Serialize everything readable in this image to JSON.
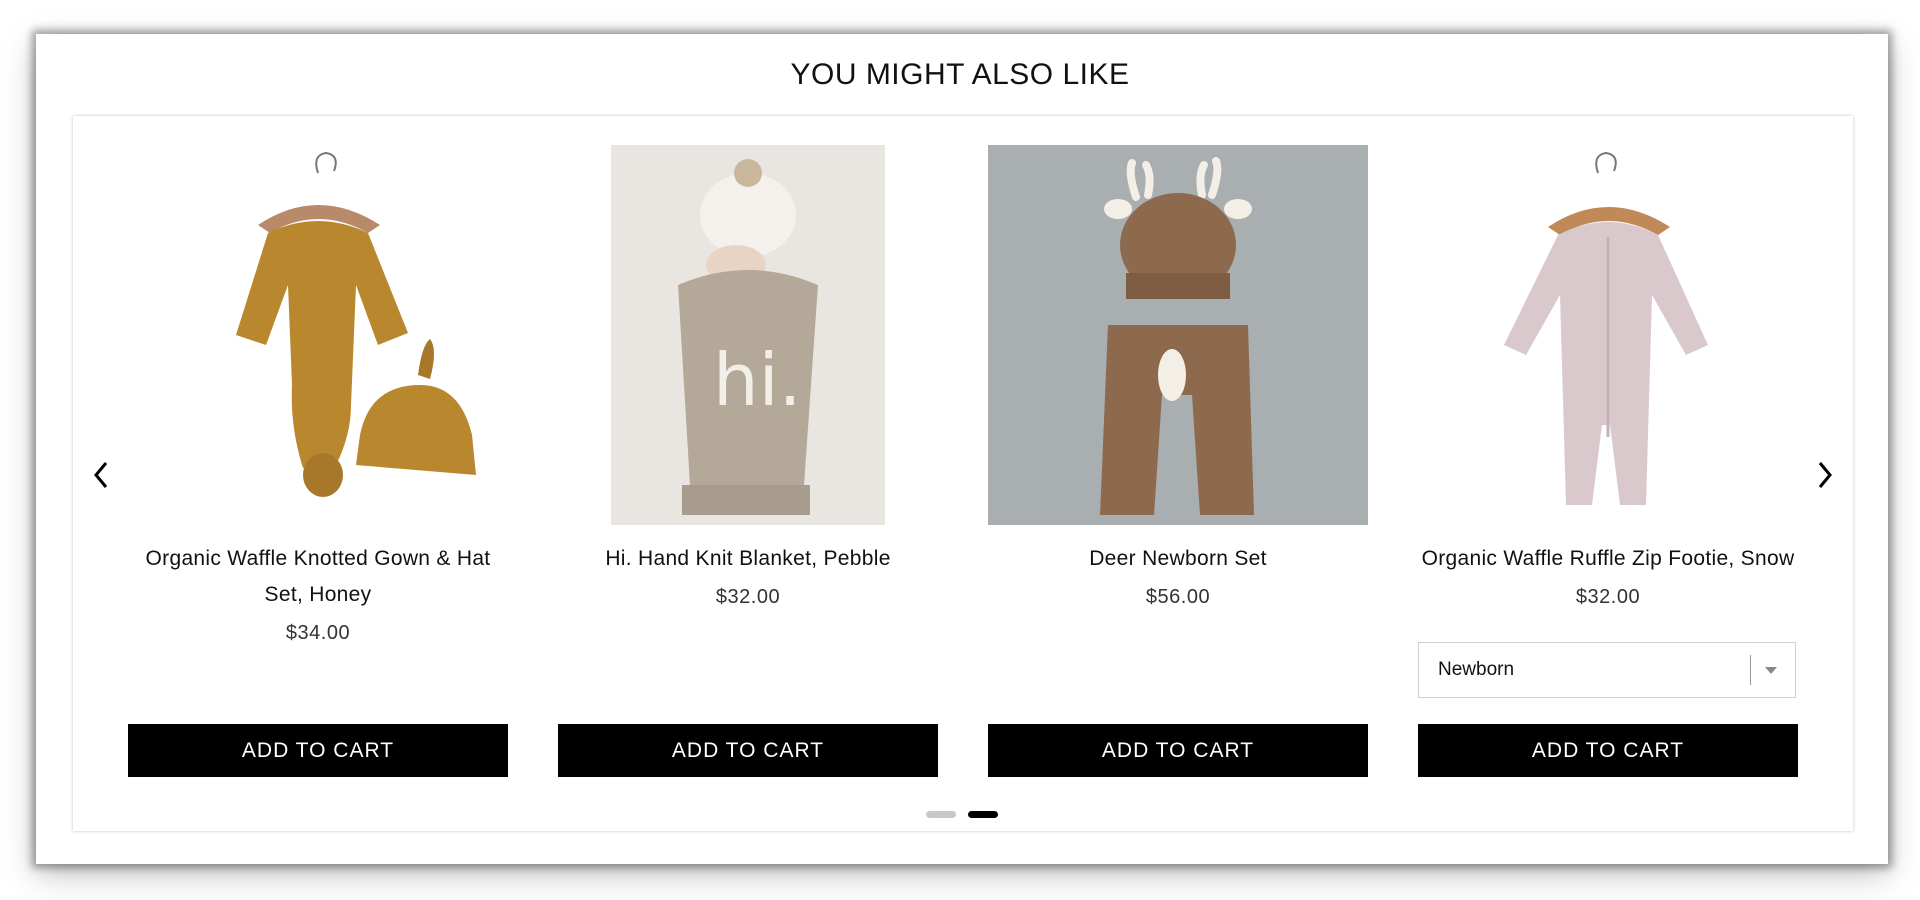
{
  "section": {
    "title": "YOU MIGHT ALSO LIKE"
  },
  "carousel": {
    "prev_icon": "chevron-left-icon",
    "next_icon": "chevron-right-icon",
    "active_page": 2,
    "page_count": 2
  },
  "products": [
    {
      "title": "Organic Waffle Knotted Gown & Hat Set, Honey",
      "price": "$34.00",
      "button": "ADD TO CART",
      "image": "mustard-gown-and-knotted-hat"
    },
    {
      "title": "Hi. Hand Knit Blanket, Pebble",
      "price": "$32.00",
      "button": "ADD TO CART",
      "image": "baby-in-knit-hi-blanket"
    },
    {
      "title": "Deer Newborn Set",
      "price": "$56.00",
      "button": "ADD TO CART",
      "image": "knit-deer-hat-and-pants"
    },
    {
      "title": "Organic Waffle Ruffle Zip Footie, Snow",
      "price": "$32.00",
      "button": "ADD TO CART",
      "image": "pale-pink-zip-footie",
      "size_option": "Newborn"
    }
  ],
  "colors": {
    "button_bg": "#000000",
    "button_text": "#ffffff",
    "dot_inactive": "#c8c8c8",
    "dot_active": "#000000"
  }
}
